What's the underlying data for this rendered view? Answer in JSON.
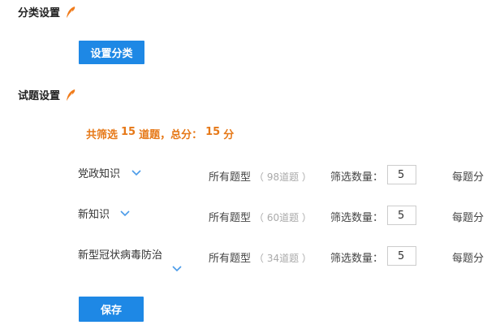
{
  "category_section": {
    "title": "分类设置",
    "button_label": "设置分类"
  },
  "question_section": {
    "title": "试题设置",
    "summary": {
      "prefix": "共筛选",
      "total_questions": "15",
      "mid": "道题，总分：",
      "total_score": "15",
      "suffix": "分"
    },
    "rows": [
      {
        "category": "党政知识",
        "type_label": "所有题型",
        "type_count": "（ 98道题 ）",
        "filter_label": "筛选数量：",
        "filter_value": "5",
        "score_label": "每题分"
      },
      {
        "category": "新知识",
        "type_label": "所有题型",
        "type_count": "（ 60道题 ）",
        "filter_label": "筛选数量：",
        "filter_value": "5",
        "score_label": "每题分"
      },
      {
        "category": "新型冠状病毒防治",
        "type_label": "所有题型",
        "type_count": "（ 34道题 ）",
        "filter_label": "筛选数量：",
        "filter_value": "5",
        "score_label": "每题分"
      }
    ],
    "save_label": "保存"
  },
  "colors": {
    "primary": "#1e88e5",
    "accent": "#e67817",
    "chevron": "#4a9be8"
  }
}
